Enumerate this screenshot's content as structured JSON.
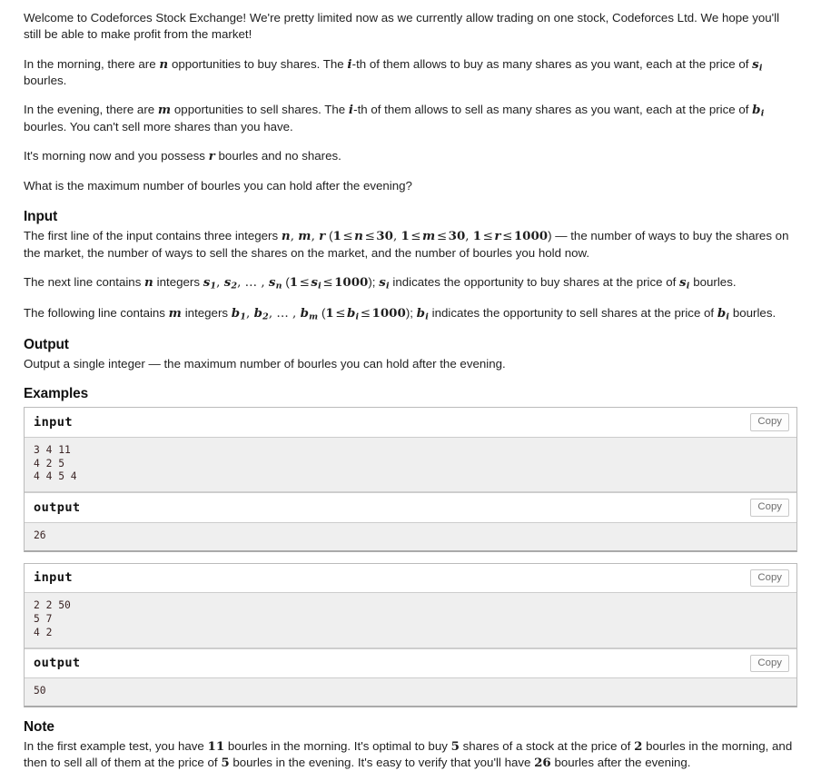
{
  "statement": {
    "paragraphs": [
      {
        "id": "intro",
        "parts": [
          {
            "t": "text",
            "v": "Welcome to Codeforces Stock Exchange! We're pretty limited now as we currently allow trading on one stock, Codeforces Ltd. We hope you'll still be able to make profit from the market!"
          }
        ]
      },
      {
        "id": "morning",
        "parts": [
          {
            "t": "text",
            "v": "In the morning, there are "
          },
          {
            "t": "math",
            "v": "n"
          },
          {
            "t": "text",
            "v": " opportunities to buy shares. The "
          },
          {
            "t": "math",
            "v": "i"
          },
          {
            "t": "text",
            "v": "-th of them allows to buy as many shares as you want, each at the price of "
          },
          {
            "t": "math",
            "v": "s",
            "sub": "i"
          },
          {
            "t": "text",
            "v": " bourles."
          }
        ]
      },
      {
        "id": "evening",
        "parts": [
          {
            "t": "text",
            "v": "In the evening, there are "
          },
          {
            "t": "math",
            "v": "m"
          },
          {
            "t": "text",
            "v": " opportunities to sell shares. The "
          },
          {
            "t": "math",
            "v": "i"
          },
          {
            "t": "text",
            "v": "-th of them allows to sell as many shares as you want, each at the price of "
          },
          {
            "t": "math",
            "v": "b",
            "sub": "i"
          },
          {
            "t": "text",
            "v": " bourles. You can't sell more shares than you have."
          }
        ]
      },
      {
        "id": "possess",
        "parts": [
          {
            "t": "text",
            "v": "It's morning now and you possess "
          },
          {
            "t": "math",
            "v": "r"
          },
          {
            "t": "text",
            "v": " bourles and no shares."
          }
        ]
      },
      {
        "id": "question",
        "parts": [
          {
            "t": "text",
            "v": "What is the maximum number of bourles you can hold after the evening?"
          }
        ]
      }
    ]
  },
  "input_section": {
    "title": "Input",
    "paragraphs": [
      {
        "id": "input-first-line",
        "parts": [
          {
            "t": "text",
            "v": "The first line of the input contains three integers "
          },
          {
            "t": "math",
            "v": "n"
          },
          {
            "t": "msep",
            "v": ", "
          },
          {
            "t": "math",
            "v": "m"
          },
          {
            "t": "msep",
            "v": ", "
          },
          {
            "t": "math",
            "v": "r"
          },
          {
            "t": "text",
            "v": " ("
          },
          {
            "t": "num",
            "v": "1"
          },
          {
            "t": "op",
            "v": "≤"
          },
          {
            "t": "math",
            "v": "n"
          },
          {
            "t": "op",
            "v": "≤"
          },
          {
            "t": "num",
            "v": "30"
          },
          {
            "t": "msep",
            "v": ", "
          },
          {
            "t": "num",
            "v": "1"
          },
          {
            "t": "op",
            "v": "≤"
          },
          {
            "t": "math",
            "v": "m"
          },
          {
            "t": "op",
            "v": "≤"
          },
          {
            "t": "num",
            "v": "30"
          },
          {
            "t": "msep",
            "v": ", "
          },
          {
            "t": "num",
            "v": "1"
          },
          {
            "t": "op",
            "v": "≤"
          },
          {
            "t": "math",
            "v": "r"
          },
          {
            "t": "op",
            "v": "≤"
          },
          {
            "t": "num",
            "v": "1000"
          },
          {
            "t": "text",
            "v": ") — the number of ways to buy the shares on the market, the number of ways to sell the shares on the market, and the number of bourles you hold now."
          }
        ]
      },
      {
        "id": "input-second-line",
        "parts": [
          {
            "t": "text",
            "v": "The next line contains "
          },
          {
            "t": "math",
            "v": "n"
          },
          {
            "t": "text",
            "v": " integers "
          },
          {
            "t": "math",
            "v": "s",
            "sub": "1"
          },
          {
            "t": "msep",
            "v": ", "
          },
          {
            "t": "math",
            "v": "s",
            "sub": "2"
          },
          {
            "t": "msep",
            "v": ", … , "
          },
          {
            "t": "math",
            "v": "s",
            "sub": "n"
          },
          {
            "t": "text",
            "v": " ("
          },
          {
            "t": "num",
            "v": "1"
          },
          {
            "t": "op",
            "v": "≤"
          },
          {
            "t": "math",
            "v": "s",
            "sub": "i"
          },
          {
            "t": "op",
            "v": "≤"
          },
          {
            "t": "num",
            "v": "1000"
          },
          {
            "t": "text",
            "v": "); "
          },
          {
            "t": "math",
            "v": "s",
            "sub": "i"
          },
          {
            "t": "text",
            "v": " indicates the opportunity to buy shares at the price of "
          },
          {
            "t": "math",
            "v": "s",
            "sub": "i"
          },
          {
            "t": "text",
            "v": " bourles."
          }
        ]
      },
      {
        "id": "input-third-line",
        "parts": [
          {
            "t": "text",
            "v": "The following line contains "
          },
          {
            "t": "math",
            "v": "m"
          },
          {
            "t": "text",
            "v": " integers "
          },
          {
            "t": "math",
            "v": "b",
            "sub": "1"
          },
          {
            "t": "msep",
            "v": ", "
          },
          {
            "t": "math",
            "v": "b",
            "sub": "2"
          },
          {
            "t": "msep",
            "v": ", … , "
          },
          {
            "t": "math",
            "v": "b",
            "sub": "m"
          },
          {
            "t": "text",
            "v": " ("
          },
          {
            "t": "num",
            "v": "1"
          },
          {
            "t": "op",
            "v": "≤"
          },
          {
            "t": "math",
            "v": "b",
            "sub": "i"
          },
          {
            "t": "op",
            "v": "≤"
          },
          {
            "t": "num",
            "v": "1000"
          },
          {
            "t": "text",
            "v": "); "
          },
          {
            "t": "math",
            "v": "b",
            "sub": "i"
          },
          {
            "t": "text",
            "v": " indicates the opportunity to sell shares at the price of "
          },
          {
            "t": "math",
            "v": "b",
            "sub": "i"
          },
          {
            "t": "text",
            "v": " bourles."
          }
        ]
      }
    ]
  },
  "output_section": {
    "title": "Output",
    "paragraphs": [
      {
        "id": "output-desc",
        "parts": [
          {
            "t": "text",
            "v": "Output a single integer — the maximum number of bourles you can hold after the evening."
          }
        ]
      }
    ]
  },
  "examples_section": {
    "title": "Examples",
    "copy_label": "Copy",
    "input_label": "input",
    "output_label": "output",
    "tests": [
      {
        "input": "3 4 11\n4 2 5\n4 4 5 4",
        "output": "26"
      },
      {
        "input": "2 2 50\n5 7\n4 2",
        "output": "50"
      }
    ]
  },
  "note_section": {
    "title": "Note",
    "paragraphs": [
      {
        "id": "note-body",
        "parts": [
          {
            "t": "text",
            "v": "In the first example test, you have "
          },
          {
            "t": "num",
            "v": "11"
          },
          {
            "t": "text",
            "v": " bourles in the morning. It's optimal to buy "
          },
          {
            "t": "num",
            "v": "5"
          },
          {
            "t": "text",
            "v": " shares of a stock at the price of "
          },
          {
            "t": "num",
            "v": "2"
          },
          {
            "t": "text",
            "v": " bourles in the morning, and then to sell all of them at the price of "
          },
          {
            "t": "num",
            "v": "5"
          },
          {
            "t": "text",
            "v": " bourles in the evening. It's easy to verify that you'll have "
          },
          {
            "t": "num",
            "v": "26"
          },
          {
            "t": "text",
            "v": " bourles after the evening."
          }
        ]
      }
    ]
  },
  "colors": {
    "text": "#1f1f1f",
    "heading": "#111111",
    "sample_bg": "#efefef",
    "sample_text": "#3b2525",
    "border": "#bbbbbb",
    "copy_text": "#6f6f6f"
  }
}
